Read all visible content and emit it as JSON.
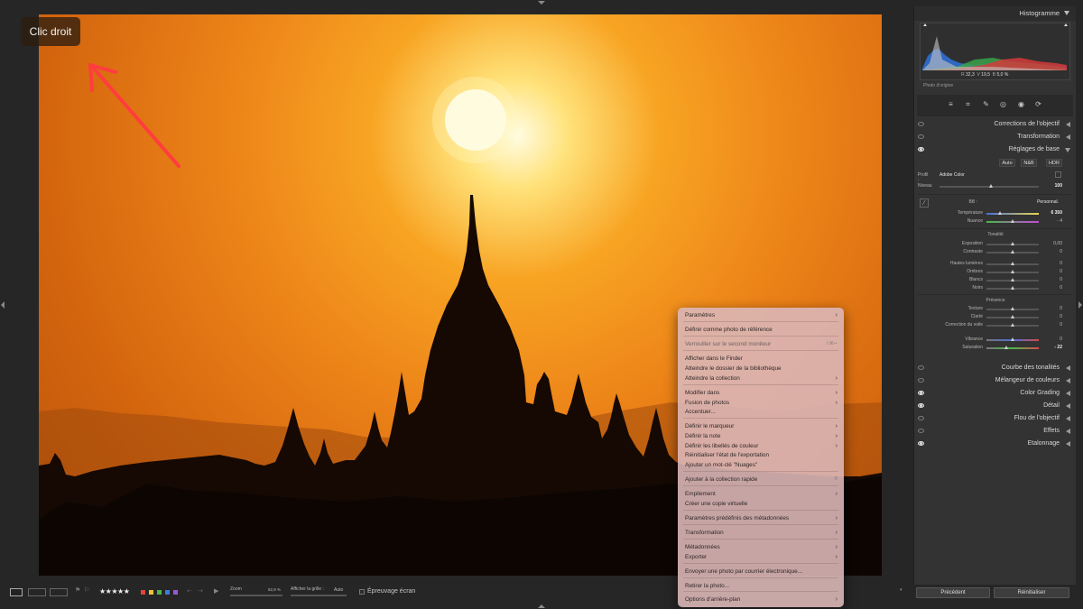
{
  "badge": {
    "text": "Clic droit"
  },
  "histogram": {
    "title": "Histogramme",
    "readout": {
      "r_label": "R",
      "r_value": "32,3",
      "g_label": "V",
      "g_value": "19,5",
      "b_label": "B",
      "b_value": "5,0 %"
    },
    "footer": "Photo d'origine"
  },
  "panels": {
    "lens_corrections": "Corrections de l'objectif",
    "transform": "Transformation",
    "basic": "Réglages de base",
    "tone_curve": "Courbe des tonalités",
    "color_mixer": "Mélangeur de couleurs",
    "color_grading": "Color Grading",
    "detail": "Détail",
    "lens_blur": "Flou de l'objectif",
    "effects": "Effets",
    "calibration": "Etalonnage"
  },
  "basic": {
    "auto": "Auto",
    "bw": "N&B",
    "hdr": "HDR",
    "profile_label": "Profil :",
    "profile_value": "Adobe Color",
    "amount_label": "Niveau",
    "amount_value": "100",
    "wb_label": "BB :",
    "wb_value": "Personnal.",
    "temp_label": "Température",
    "temp_value": "6 350",
    "tint_label": "Nuance",
    "tint_value": "- 4",
    "tone_title": "Tonalité",
    "exposure_label": "Exposition",
    "exposure_value": "0,00",
    "contrast_label": "Contraste",
    "contrast_value": "0",
    "highlights_label": "Hautes lumières",
    "highlights_value": "0",
    "shadows_label": "Ombres",
    "shadows_value": "0",
    "whites_label": "Blancs",
    "whites_value": "0",
    "blacks_label": "Noirs",
    "blacks_value": "0",
    "presence_title": "Présence",
    "texture_label": "Texture",
    "texture_value": "0",
    "clarity_label": "Clarté",
    "clarity_value": "0",
    "dehaze_label": "Correction du voile",
    "dehaze_value": "0",
    "vibrance_label": "Vibrance",
    "vibrance_value": "0",
    "saturation_label": "Saturation",
    "saturation_value": "- 22"
  },
  "panel_buttons": {
    "previous": "Précédent",
    "reset": "Réinitialiser"
  },
  "toolbar": {
    "stars": "★★★★★",
    "zoom_label": "Zoom",
    "zoom_value": "82,9 %",
    "grid_label": "Afficher la grille :",
    "grid_value": "Auto",
    "proof_label": "Épreuvage écran",
    "color_labels": [
      "#e0463e",
      "#e8c53a",
      "#4bb84b",
      "#3d7be0",
      "#9a57d6"
    ]
  },
  "context_menu": {
    "items": [
      {
        "label": "Paramètres",
        "submenu": true,
        "dim": false
      },
      {
        "label": "Définir comme photo de référence",
        "submenu": false,
        "dim": false
      },
      {
        "label": "Verrouiller sur le second moniteur",
        "submenu": false,
        "dim": true,
        "shortcut": "⇧⌘↵"
      },
      {
        "label": "Afficher dans le Finder",
        "submenu": false,
        "dim": false
      },
      {
        "label": "Atteindre le dossier de la bibliothèque",
        "submenu": false,
        "dim": false
      },
      {
        "label": "Atteindre la collection",
        "submenu": true,
        "dim": false
      },
      {
        "label": "Modifier dans",
        "submenu": true,
        "dim": false
      },
      {
        "label": "Fusion de photos",
        "submenu": true,
        "dim": false
      },
      {
        "label": "Accentuer...",
        "submenu": false,
        "dim": false
      },
      {
        "label": "Définir le marqueur",
        "submenu": true,
        "dim": false
      },
      {
        "label": "Définir la note",
        "submenu": true,
        "dim": false
      },
      {
        "label": "Définir les libellés de couleur",
        "submenu": true,
        "dim": false
      },
      {
        "label": "Réinitialiser l'état de l'exportation",
        "submenu": false,
        "dim": false
      },
      {
        "label": "Ajouter un mot-clé \"Nuages\"",
        "submenu": false,
        "dim": false
      },
      {
        "label": "Ajouter à la collection rapide",
        "submenu": false,
        "dim": false,
        "shortcut": "B"
      },
      {
        "label": "Empilement",
        "submenu": true,
        "dim": false
      },
      {
        "label": "Créer une copie virtuelle",
        "submenu": false,
        "dim": false
      },
      {
        "label": "Paramètres prédéfinis des métadonnées",
        "submenu": true,
        "dim": false
      },
      {
        "label": "Transformation",
        "submenu": true,
        "dim": false
      },
      {
        "label": "Métadonnées",
        "submenu": true,
        "dim": false
      },
      {
        "label": "Exporter",
        "submenu": true,
        "dim": false
      },
      {
        "label": "Envoyer une photo par courrier électronique...",
        "submenu": false,
        "dim": false
      },
      {
        "label": "Retirer la photo...",
        "submenu": false,
        "dim": false
      },
      {
        "label": "Options d'arrière-plan",
        "submenu": true,
        "dim": false
      }
    ]
  }
}
